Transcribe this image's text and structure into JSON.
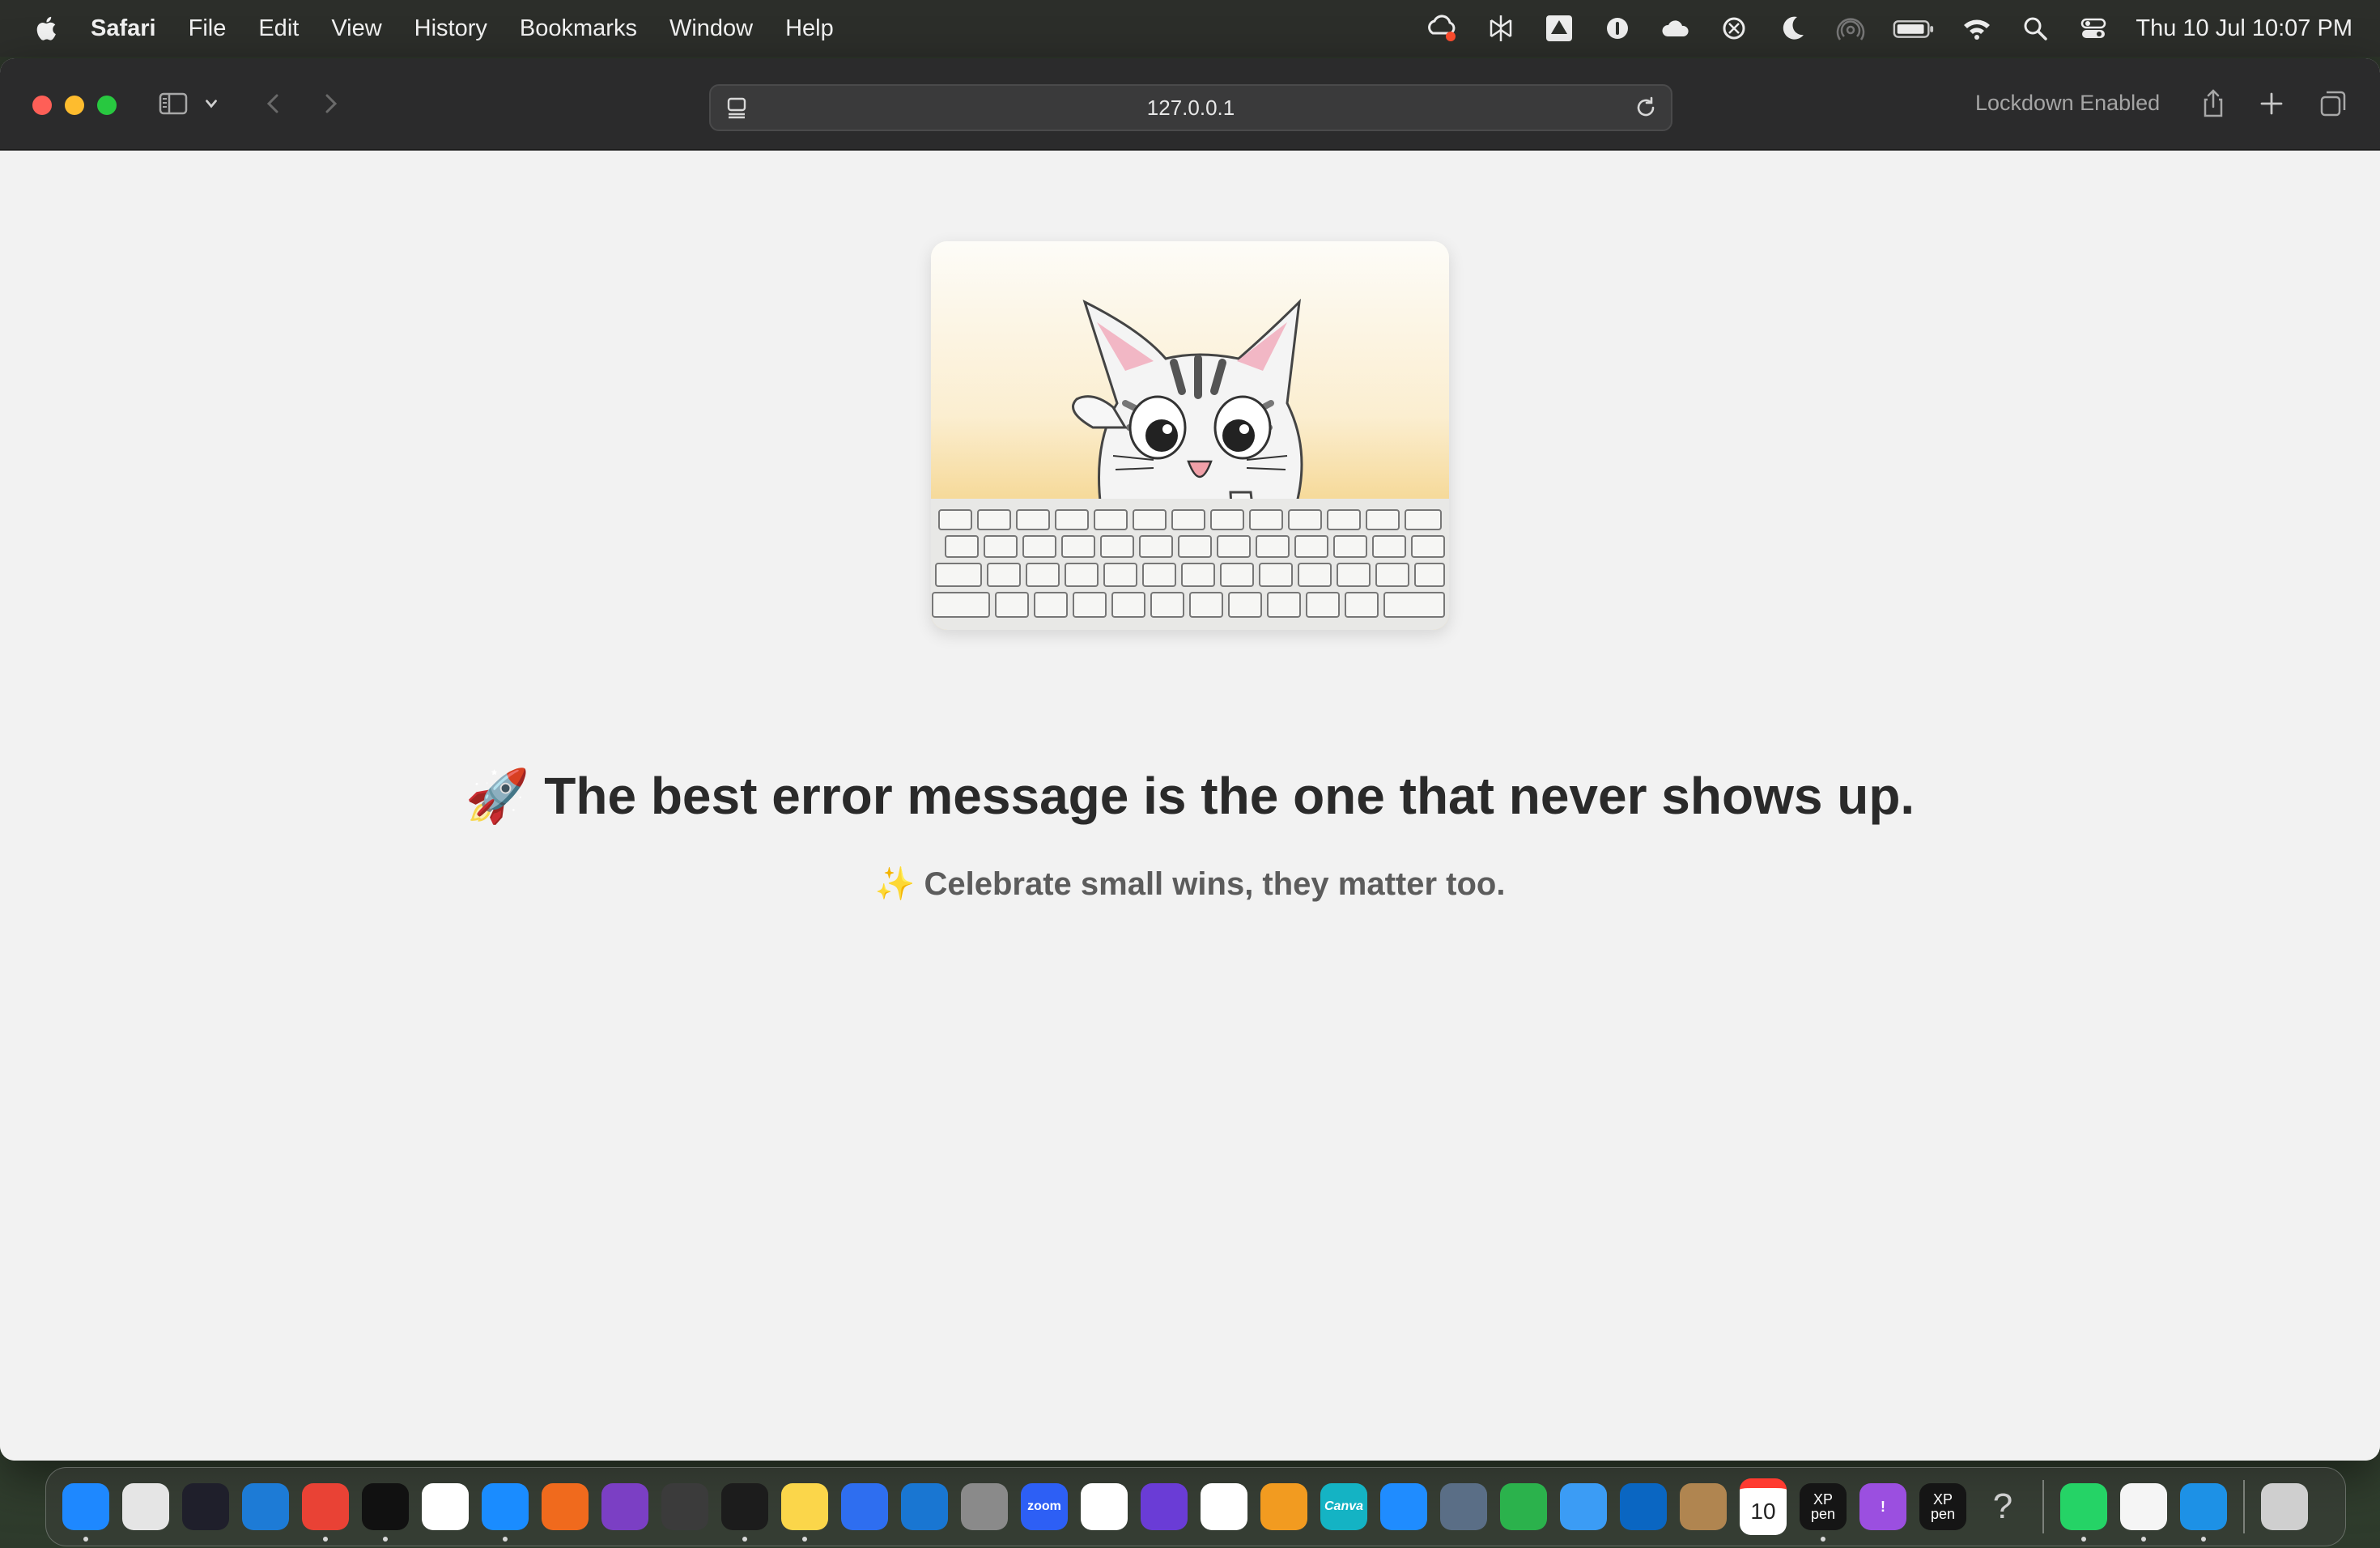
{
  "menubar": {
    "app": "Safari",
    "items": [
      "File",
      "Edit",
      "View",
      "History",
      "Bookmarks",
      "Window",
      "Help"
    ],
    "status_icons": [
      "creative-cloud-icon",
      "perplexity-icon",
      "google-drive-icon",
      "onepassword-icon",
      "icloud-icon",
      "chatgpt-icon",
      "moon-icon",
      "airdrop-icon",
      "battery-icon",
      "wifi-icon",
      "spotlight-search-icon",
      "control-center-icon"
    ],
    "clock": "Thu 10 Jul  10:07 PM"
  },
  "browser": {
    "address": "127.0.0.1",
    "lockdown": "Lockdown Enabled"
  },
  "page": {
    "headline": "🚀 The best error message is the one that never shows up.",
    "subline": "✨ Celebrate small wins, they matter too."
  },
  "dock": {
    "apps": [
      {
        "name": "finder",
        "label": "",
        "color": "#1e88ff",
        "running": true
      },
      {
        "name": "launchpad",
        "label": "",
        "color": "#e5e5e5",
        "running": false
      },
      {
        "name": "obs",
        "label": "",
        "color": "#1f1f2b",
        "running": false
      },
      {
        "name": "vscode",
        "label": "",
        "color": "#1d7bd6",
        "running": false
      },
      {
        "name": "chrome",
        "label": "",
        "color": "#e94235",
        "running": true
      },
      {
        "name": "githubdesktop-pen",
        "label": "",
        "color": "#111111",
        "running": true
      },
      {
        "name": "chatgpt",
        "label": "",
        "color": "#ffffff",
        "running": false
      },
      {
        "name": "safari",
        "label": "",
        "color": "#1a8cff",
        "running": true
      },
      {
        "name": "sourcetree",
        "label": "",
        "color": "#f06a1d",
        "running": false
      },
      {
        "name": "github",
        "label": "",
        "color": "#7b3fc4",
        "running": false
      },
      {
        "name": "screenshot",
        "label": "",
        "color": "#3b3b3b",
        "running": false
      },
      {
        "name": "terminal",
        "label": "",
        "color": "#1c1c1c",
        "running": true
      },
      {
        "name": "notes",
        "label": "",
        "color": "#fbd64a",
        "running": true
      },
      {
        "name": "freeform",
        "label": "",
        "color": "#2e6ef0",
        "running": false
      },
      {
        "name": "onedrive",
        "label": "",
        "color": "#1976d2",
        "running": false
      },
      {
        "name": "system-settings",
        "label": "",
        "color": "#8a8a8a",
        "running": false
      },
      {
        "name": "zoom",
        "label": "zoom",
        "color": "#2d5ff5",
        "running": false
      },
      {
        "name": "google-drive",
        "label": "",
        "color": "#ffffff",
        "running": false
      },
      {
        "name": "imovie",
        "label": "",
        "color": "#6a3cd6",
        "running": false
      },
      {
        "name": "reminders",
        "label": "",
        "color": "#ffffff",
        "running": false
      },
      {
        "name": "pages",
        "label": "",
        "color": "#f29b20",
        "running": false
      },
      {
        "name": "canva",
        "label": "Canva",
        "color": "#14b3c4",
        "running": false
      },
      {
        "name": "app-store",
        "label": "",
        "color": "#1f8cff",
        "running": false
      },
      {
        "name": "preview",
        "label": "",
        "color": "#5a6e86",
        "running": false
      },
      {
        "name": "numbers",
        "label": "",
        "color": "#2bb24c",
        "running": false
      },
      {
        "name": "mail",
        "label": "",
        "color": "#3b9cf5",
        "running": false
      },
      {
        "name": "outlook",
        "label": "",
        "color": "#0a66c2",
        "running": false
      },
      {
        "name": "contacts",
        "label": "",
        "color": "#b08550",
        "running": false
      },
      {
        "name": "calendar",
        "label": "10",
        "color": "#ffffff",
        "running": false
      },
      {
        "name": "xp-pen-1",
        "label": "XP pen",
        "color": "#151515",
        "running": true
      },
      {
        "name": "feedback",
        "label": "!",
        "color": "#9b4fe0",
        "running": false
      },
      {
        "name": "xp-pen-2",
        "label": "XP pen",
        "color": "#151515",
        "running": false
      },
      {
        "name": "help",
        "label": "?",
        "color": "transparent",
        "running": false
      },
      {
        "name": "whatsapp",
        "label": "",
        "color": "#25d366",
        "running": true
      },
      {
        "name": "textedit",
        "label": "",
        "color": "#f5f5f5",
        "running": true
      },
      {
        "name": "docker",
        "label": "",
        "color": "#1d91e6",
        "running": true
      },
      {
        "name": "trash",
        "label": "",
        "color": "#cfcfcf",
        "running": false
      }
    ]
  }
}
